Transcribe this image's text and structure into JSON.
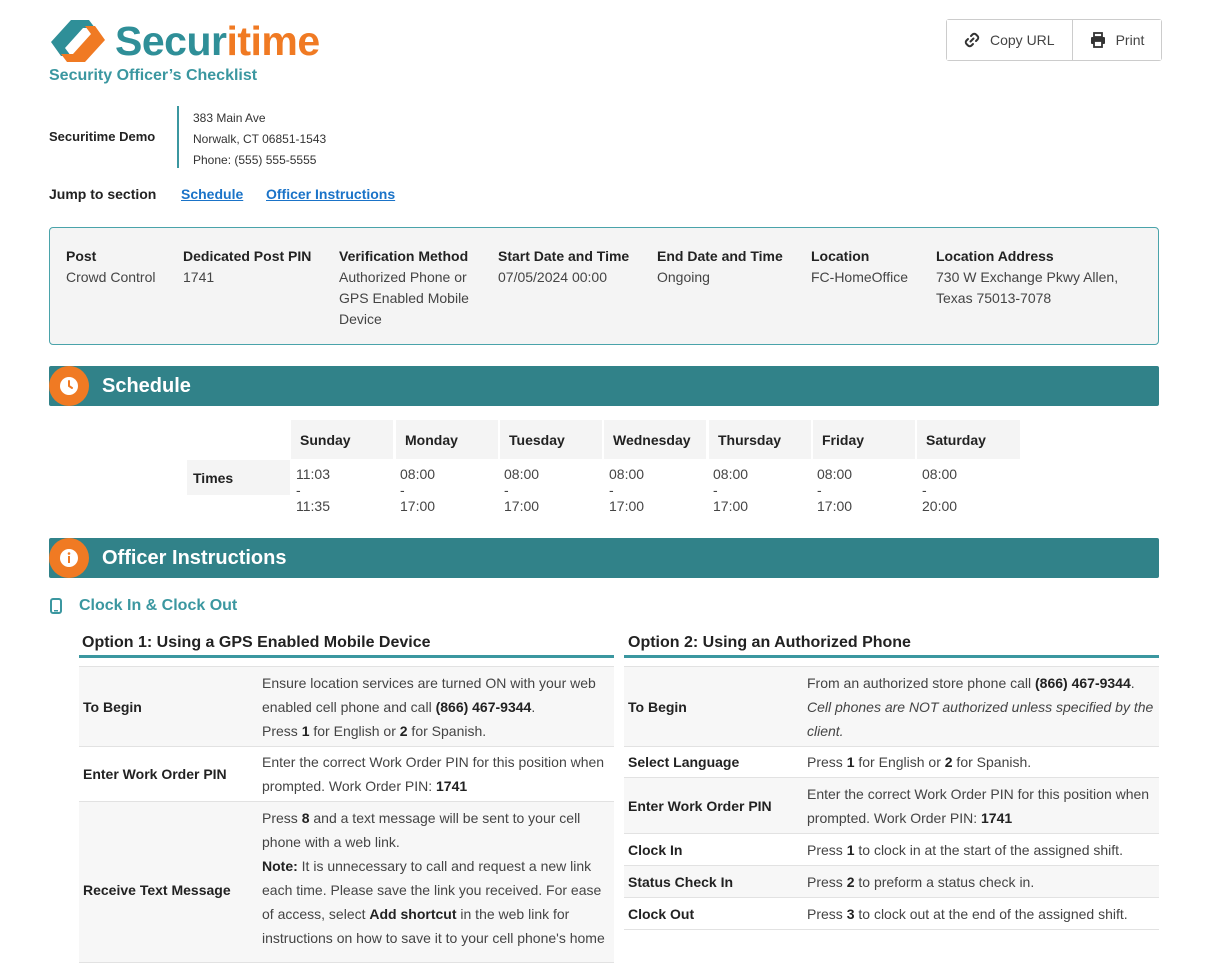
{
  "header": {
    "brand_part1": "Secur",
    "brand_part2": "itime",
    "subtitle": "Security Officer’s Checklist",
    "copy_url_label": "Copy URL",
    "print_label": "Print"
  },
  "company": {
    "name": "Securitime Demo",
    "address_line1": "383 Main Ave",
    "address_line2": "Norwalk, CT 06851-1543",
    "phone": "Phone: (555) 555-5555"
  },
  "jump": {
    "label": "Jump to section",
    "links": [
      "Schedule",
      "Officer Instructions"
    ]
  },
  "post_info": [
    {
      "heading": "Post",
      "value": "Crowd Control"
    },
    {
      "heading": "Dedicated Post PIN",
      "value": "1741"
    },
    {
      "heading": "Verification Method",
      "value": "Authorized Phone or GPS Enabled Mobile Device"
    },
    {
      "heading": "Start Date and Time",
      "value": "07/05/2024 00:00"
    },
    {
      "heading": "End Date and Time",
      "value": "Ongoing"
    },
    {
      "heading": "Location",
      "value": "FC-HomeOffice"
    },
    {
      "heading": "Location Address",
      "value": "730 W Exchange Pkwy Allen, Texas 75013-7078"
    }
  ],
  "schedule": {
    "title": "Schedule",
    "row_label": "Times",
    "days": [
      {
        "day": "Sunday",
        "time": "11:03 - 11:35"
      },
      {
        "day": "Monday",
        "time": "08:00 - 17:00"
      },
      {
        "day": "Tuesday",
        "time": "08:00 - 17:00"
      },
      {
        "day": "Wednesday",
        "time": "08:00 - 17:00"
      },
      {
        "day": "Thursday",
        "time": "08:00 - 17:00"
      },
      {
        "day": "Friday",
        "time": "08:00 - 17:00"
      },
      {
        "day": "Saturday",
        "time": "08:00 - 20:00"
      }
    ]
  },
  "instructions": {
    "title": "Officer Instructions",
    "clock_title": "Clock In & Clock Out",
    "option1": {
      "heading": "Option 1: Using a GPS Enabled Mobile Device",
      "to_begin_label": "To Begin",
      "to_begin_1": "Ensure location services are turned ON with your web enabled cell phone and call ",
      "phone_number": "(866) 467-9344",
      "period": ".",
      "press": "Press ",
      "key1": "1",
      "for_english_or": " for English or ",
      "key2": "2",
      "for_spanish": " for Spanish.",
      "pin_label": "Enter Work Order PIN",
      "pin_text": "Enter the correct Work Order PIN for this position when prompted. Work Order PIN: ",
      "pin_value": "1741",
      "text_label": "Receive Text Message",
      "key8": "8",
      "text_1": " and a text message will be sent to your cell phone with a web link.",
      "note_label": "Note:",
      "note_text": " It is unnecessary to call and request a new link each time. Please save the link you received. For ease of access, select ",
      "add_shortcut": "Add shortcut",
      "note_text2": " in the web link for instructions on how to save it to your cell phone's home"
    },
    "option2": {
      "heading": "Option 2: Using an Authorized Phone",
      "to_begin_label": "To Begin",
      "to_begin_1": "From an authorized store phone call ",
      "phone_number": "(866) 467-9344",
      "period": ".",
      "cell_note": "Cell phones are NOT authorized unless specified by the client.",
      "lang_label": "Select Language",
      "press": "Press ",
      "key1": "1",
      "for_english_or": " for English or ",
      "key2": "2",
      "for_spanish": " for Spanish.",
      "pin_label": "Enter Work Order PIN",
      "pin_text": "Enter the correct Work Order PIN for this position when prompted. Work Order PIN: ",
      "pin_value": "1741",
      "clock_in_label": "Clock In",
      "clock_in_text": " to clock in at the start of the assigned shift.",
      "status_label": "Status Check In",
      "key_status": "2",
      "status_text": " to preform a status check in.",
      "clock_out_label": "Clock Out",
      "key_out": "3",
      "clock_out_text": " to clock out at the end of the assigned shift."
    }
  },
  "colors": {
    "teal": "#318289",
    "orange": "#f07a23",
    "link": "#1a73c8"
  }
}
